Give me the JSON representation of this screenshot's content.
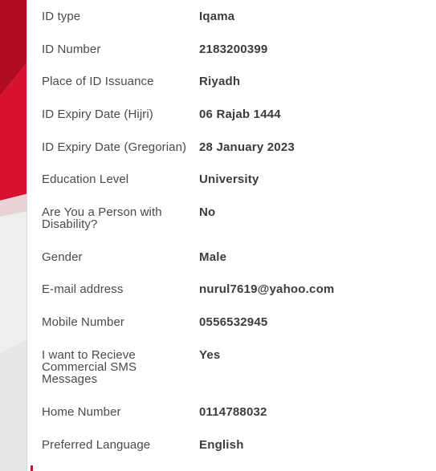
{
  "rows": [
    {
      "label": "ID type",
      "value": "Iqama"
    },
    {
      "label": "ID Number",
      "value": "2183200399"
    },
    {
      "label": "Place of ID Issuance",
      "value": "Riyadh"
    },
    {
      "label": "ID Expiry Date (Hijri)",
      "value": "06 Rajab 1444"
    },
    {
      "label": "ID Expiry Date (Gregorian)",
      "value": "28 January 2023"
    },
    {
      "label": "Education Level",
      "value": "University"
    },
    {
      "label": "Are You a Person with Disability?",
      "value": "No"
    },
    {
      "label": "Gender",
      "value": "Male"
    },
    {
      "label": "E-mail address",
      "value": "nurul7619@yahoo.com"
    },
    {
      "label": "Mobile Number",
      "value": "0556532945"
    },
    {
      "label": "I want to Recieve Commercial SMS Messages",
      "value": "Yes"
    },
    {
      "label": "Home Number",
      "value": "0114788032"
    },
    {
      "label": "Preferred Language",
      "value": "English"
    }
  ],
  "colors": {
    "brand_red": "#c4122f",
    "label_text": "#4a4a4a",
    "value_text": "#3c3c3c"
  }
}
